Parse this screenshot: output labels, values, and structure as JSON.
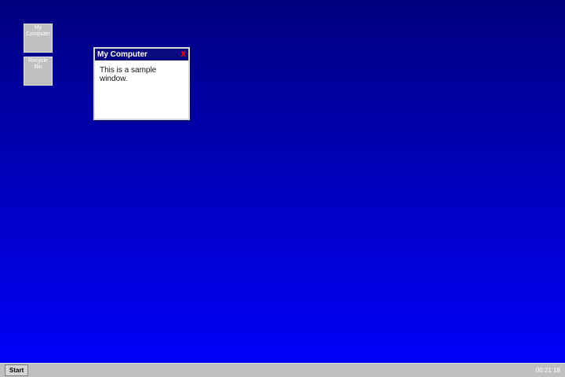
{
  "desktop": {
    "background_top": "#00007f",
    "background_bottom": "#0000ff",
    "icons": [
      {
        "label": "My Computer"
      },
      {
        "label": "Recycle Bin"
      }
    ]
  },
  "window": {
    "title": "My Computer",
    "close_label": "X",
    "body_text": "This is a sample window.",
    "title_bar_color": "#0a0a80"
  },
  "taskbar": {
    "start_label": "Start",
    "clock": "00:21:18"
  }
}
